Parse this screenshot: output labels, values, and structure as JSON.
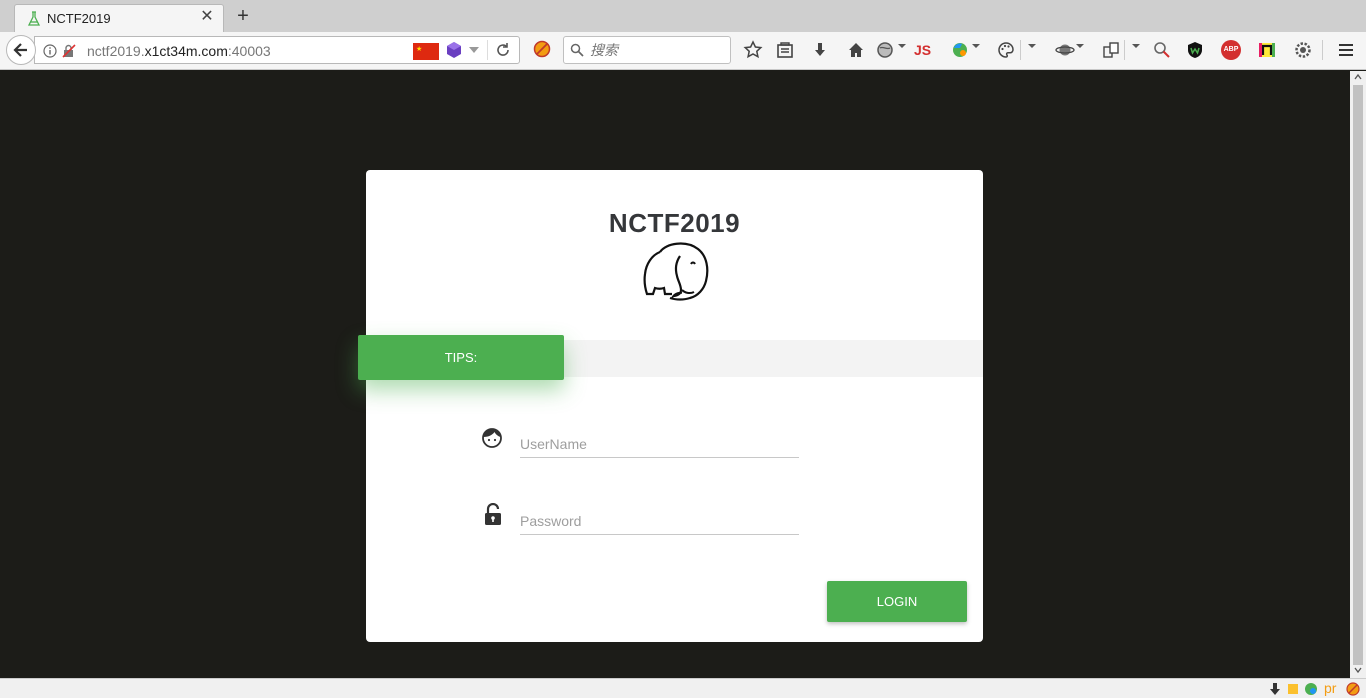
{
  "browser": {
    "tab_title": "NCTF2019",
    "url": {
      "prefix": "nctf2019.",
      "domain": "x1ct34m.com",
      "suffix": ":40003"
    },
    "search_placeholder": "搜索",
    "toolbar_js_label": "JS",
    "toolbar_abp_label": "ABP",
    "status_text": "pr"
  },
  "login_page": {
    "brand": "NCTF2019",
    "tips_label": "TIPS:",
    "username_placeholder": "UserName",
    "password_placeholder": "Password",
    "login_label": "LOGIN"
  },
  "colors": {
    "accent_green": "#4caf50",
    "page_background": "#1c1c18",
    "brand_text": "#35373a"
  }
}
